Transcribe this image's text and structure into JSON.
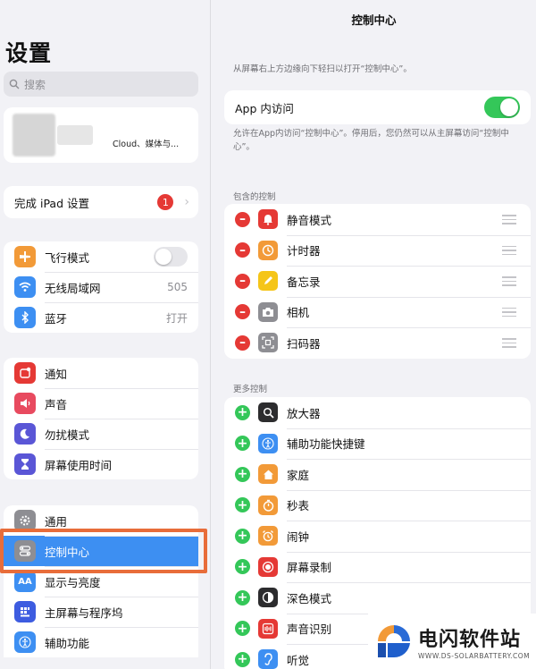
{
  "sidebar": {
    "title": "设置",
    "search_placeholder": "搜索",
    "profile_subtitle": "Cloud、媒体与...",
    "setup": {
      "label": "完成 iPad 设置",
      "badge": "1"
    },
    "connectivity": [
      {
        "label": "飞行模式",
        "icon": "airplane-icon",
        "color": "#f29a38",
        "value": ""
      },
      {
        "label": "无线局域网",
        "icon": "wifi-icon",
        "color": "#3d8ff2",
        "value": "505"
      },
      {
        "label": "蓝牙",
        "icon": "bluetooth-icon",
        "color": "#3d8ff2",
        "value": "打开"
      }
    ],
    "notifications": [
      {
        "label": "通知",
        "icon": "notification-icon",
        "color": "#e53935"
      },
      {
        "label": "声音",
        "icon": "speaker-icon",
        "color": "#e84a5f"
      },
      {
        "label": "勿扰模式",
        "icon": "moon-icon",
        "color": "#5a56d6"
      },
      {
        "label": "屏幕使用时间",
        "icon": "hourglass-icon",
        "color": "#5a56d6"
      }
    ],
    "general": [
      {
        "label": "通用",
        "icon": "gear-icon",
        "color": "#8e8e93"
      },
      {
        "label": "控制中心",
        "icon": "control-center-icon",
        "color": "#8e8e93"
      },
      {
        "label": "显示与亮度",
        "icon": "display-icon",
        "color": "#3d8ff2"
      },
      {
        "label": "主屏幕与程序坞",
        "icon": "home-screen-icon",
        "color": "#3d5ce0"
      },
      {
        "label": "辅助功能",
        "icon": "accessibility-icon",
        "color": "#3d8ff2"
      }
    ]
  },
  "content": {
    "title": "控制中心",
    "intro": "从屏幕右上方边缘向下轻扫以打开“控制中心”。",
    "app_access": {
      "label": "App 内访问",
      "enabled": true
    },
    "app_access_note": "允许在App内访问“控制中心”。停用后，您仍然可以从主屏幕访问“控制中心”。",
    "included_header": "包含的控制",
    "included": [
      {
        "label": "静音模式",
        "icon": "bell-icon",
        "color": "#e53935"
      },
      {
        "label": "计时器",
        "icon": "timer-icon",
        "color": "#f29a38"
      },
      {
        "label": "备忘录",
        "icon": "notes-icon",
        "color": "#f5c518"
      },
      {
        "label": "相机",
        "icon": "camera-icon",
        "color": "#8e8e93"
      },
      {
        "label": "扫码器",
        "icon": "qr-scanner-icon",
        "color": "#8e8e93"
      }
    ],
    "more_header": "更多控制",
    "more": [
      {
        "label": "放大器",
        "icon": "magnifier-icon",
        "color": "#2c2c2e"
      },
      {
        "label": "辅助功能快捷键",
        "icon": "accessibility-icon",
        "color": "#3d8ff2"
      },
      {
        "label": "家庭",
        "icon": "home-icon",
        "color": "#f29a38"
      },
      {
        "label": "秒表",
        "icon": "stopwatch-icon",
        "color": "#f29a38"
      },
      {
        "label": "闹钟",
        "icon": "alarm-icon",
        "color": "#f29a38"
      },
      {
        "label": "屏幕录制",
        "icon": "record-icon",
        "color": "#e53935"
      },
      {
        "label": "深色模式",
        "icon": "dark-mode-icon",
        "color": "#2c2c2e"
      },
      {
        "label": "声音识别",
        "icon": "sound-recognition-icon",
        "color": "#e53935"
      },
      {
        "label": "听觉",
        "icon": "ear-icon",
        "color": "#3d8ff2"
      }
    ]
  },
  "watermark": {
    "name": "电闪软件站",
    "url": "WWW.DS-SOLARBATTERY.COM"
  }
}
